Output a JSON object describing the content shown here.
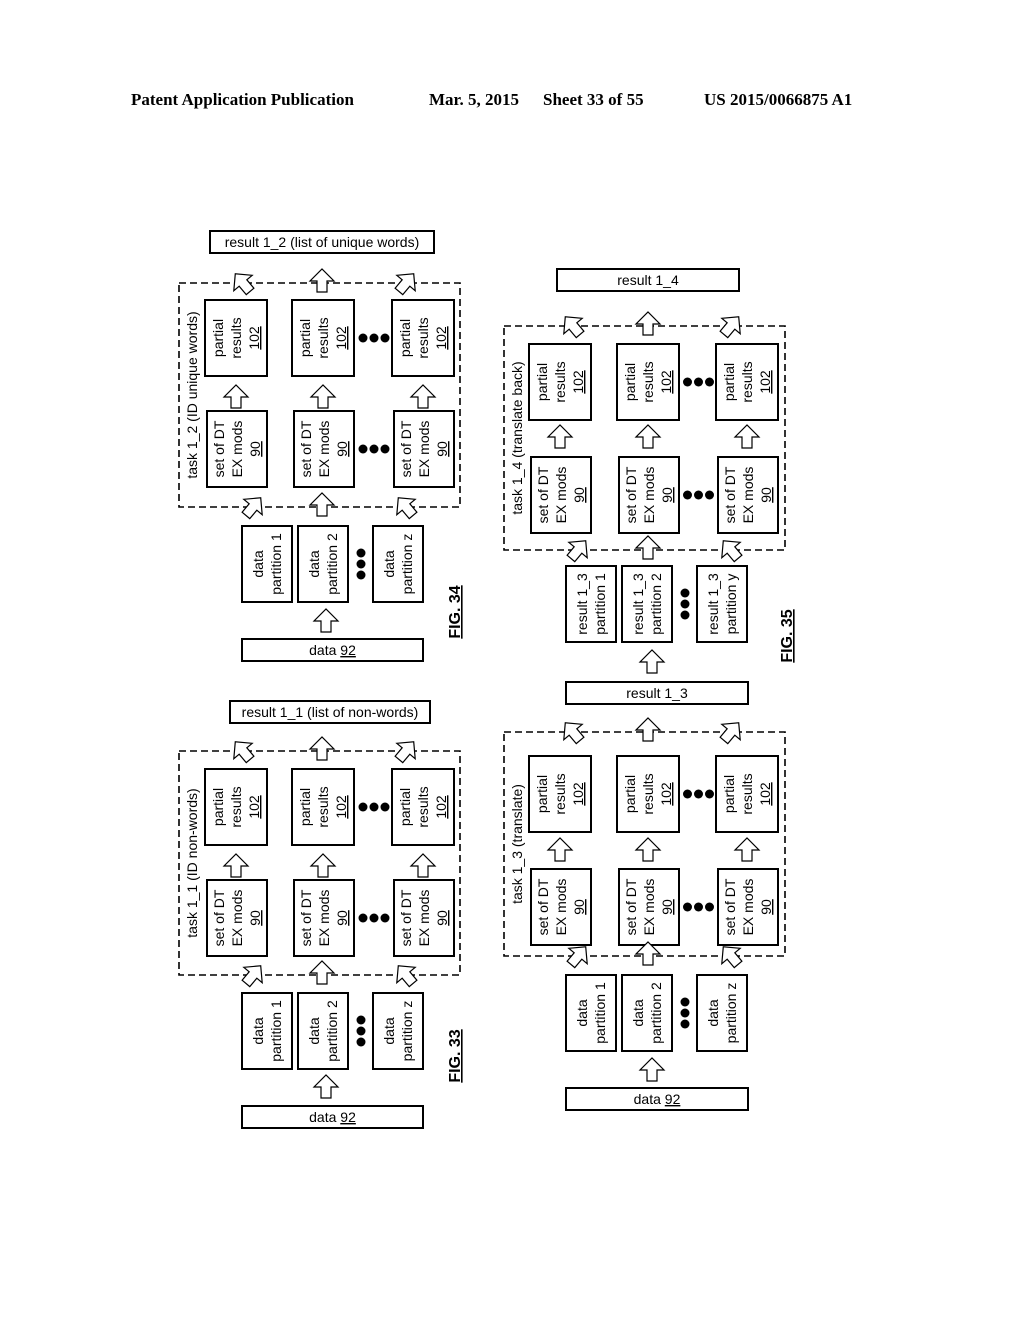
{
  "header": {
    "left": "Patent Application Publication",
    "date": "Mar. 5, 2015",
    "sheet": "Sheet 33 of 55",
    "number": "US 2015/0066875 A1"
  },
  "figures": [
    {
      "id": "fig33",
      "label": "FIG. 33",
      "task_label": "task 1_1 (ID non-words)",
      "result": "result 1_1 (list of non-words)",
      "input": {
        "text": "data ",
        "ref": "92"
      },
      "partitions": [
        [
          "data",
          "partition 1"
        ],
        [
          "data",
          "partition 2"
        ],
        [
          "data",
          "partition z"
        ]
      ],
      "module": {
        "line1": "set of DT",
        "line2": "EX mods",
        "ref": "90"
      },
      "partial": {
        "line1": "partial",
        "line2": "results",
        "ref": "102"
      }
    },
    {
      "id": "fig34",
      "label": "FIG. 34",
      "task_label": "task 1_2 (ID unique words)",
      "result": "result 1_2 (list of unique words)",
      "input": {
        "text": "data ",
        "ref": "92"
      },
      "partitions": [
        [
          "data",
          "partition 1"
        ],
        [
          "data",
          "partition 2"
        ],
        [
          "data",
          "partition z"
        ]
      ],
      "module": {
        "line1": "set of DT",
        "line2": "EX mods",
        "ref": "90"
      },
      "partial": {
        "line1": "partial",
        "line2": "results",
        "ref": "102"
      }
    },
    {
      "id": "fig35a",
      "label": "",
      "task_label": "task 1_3 (translate)",
      "result": "result 1_3",
      "input": {
        "text": "data ",
        "ref": "92"
      },
      "partitions": [
        [
          "data",
          "partition 1"
        ],
        [
          "data",
          "partition 2"
        ],
        [
          "data",
          "partition z"
        ]
      ],
      "module": {
        "line1": "set of DT",
        "line2": "EX mods",
        "ref": "90"
      },
      "partial": {
        "line1": "partial",
        "line2": "results",
        "ref": "102"
      }
    },
    {
      "id": "fig35b",
      "label": "FIG. 35",
      "task_label": "task 1_4 (translate back)",
      "result": "result 1_4",
      "input": null,
      "partitions": [
        [
          "result 1_3",
          "partition 1"
        ],
        [
          "result 1_3",
          "partition 2"
        ],
        [
          "result 1_3",
          "partition y"
        ]
      ],
      "module": {
        "line1": "set of DT",
        "line2": "EX mods",
        "ref": "90"
      },
      "partial": {
        "line1": "partial",
        "line2": "results",
        "ref": "102"
      }
    }
  ]
}
